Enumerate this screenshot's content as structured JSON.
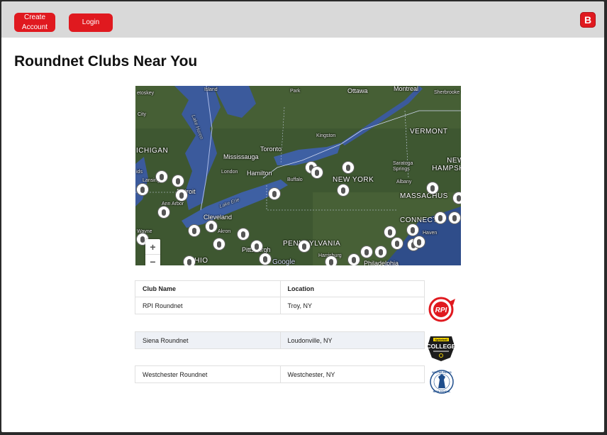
{
  "header": {
    "create_account_label": "Create Account",
    "login_label": "Login",
    "brand_letter": "B"
  },
  "page": {
    "title": "Roundnet Clubs Near You"
  },
  "map": {
    "labels": {
      "ottawa": "Ottawa",
      "montreal": "Montreal",
      "sherbrooke": "Sherbrooke",
      "etoskey": "etoskey",
      "island": "Island",
      "park": "Park",
      "city": "City",
      "vermont": "VERMONT",
      "kingston": "Kingston",
      "ichigan": "ICHIGAN",
      "toronto": "Toronto",
      "mississauga": "Mississauga",
      "london": "London",
      "hamilton": "Hamilton",
      "buffalo": "Buffalo",
      "new_york": "NEW YORK",
      "saratoga": "Saratoga Springs",
      "new_hamps": "NEW HAMPSH",
      "albany": "Albany",
      "massachus": "MASSACHUS",
      "lansing": "Lansing",
      "detroit": "Detroit",
      "ann_arbor": "Ann Arbor",
      "cleveland": "Cleveland",
      "connect": "CONNECT",
      "akron": "Akron",
      "haven": "Haven",
      "wayne": "Wayne",
      "pittsburgh": "Pittsburgh",
      "pennsylvania": "PENNSYLVANIA",
      "ohio": "OHIO",
      "harrisburg": "Harrisburg",
      "philadelphia": "Philadelphia",
      "lake_huron": "Lake Huron",
      "lake_erie": "Lake Erie",
      "ids": "ids",
      "google": "Google"
    },
    "zoom_in": "+",
    "zoom_out": "−"
  },
  "clubs_table": {
    "headers": [
      "Club Name",
      "Location"
    ],
    "rows": [
      {
        "name": "RPI Roundnet",
        "location": "Troy, NY"
      },
      {
        "name": "Siena Roundnet",
        "location": "Loudonville, NY"
      },
      {
        "name": "Westchester Roundnet",
        "location": "Westchester, NY"
      }
    ]
  },
  "logos": {
    "rpi_text": "RPI",
    "college_text": "COLLEGE",
    "college_top": "Spikeball",
    "wp_text": "WALTER PANAS HIGH SCHOOL"
  },
  "colors": {
    "brand_red": "#e0191f",
    "topbar": "#d9d9d9",
    "row_shade": "#eef1f6"
  }
}
